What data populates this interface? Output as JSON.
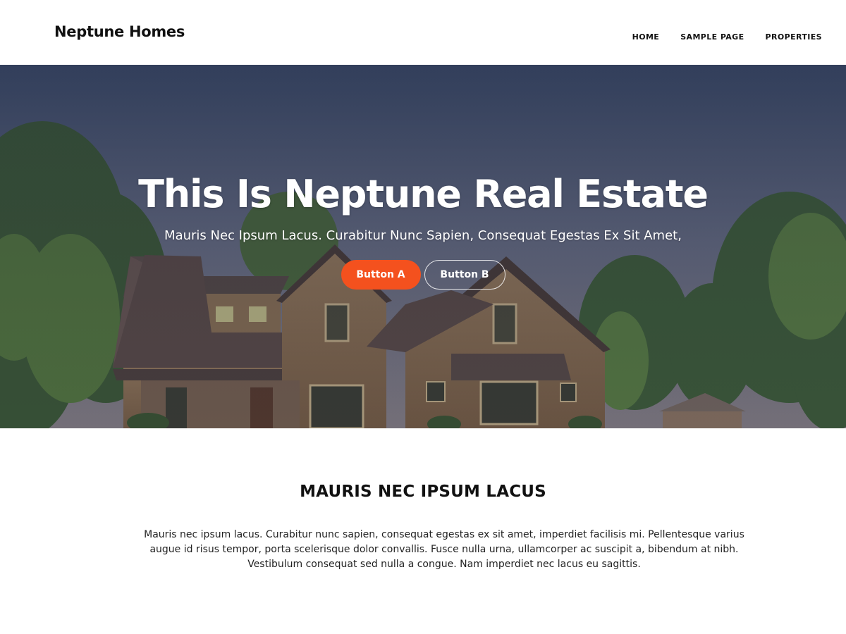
{
  "header": {
    "site_title": "Neptune Homes",
    "nav": [
      {
        "label": "HOME"
      },
      {
        "label": "SAMPLE PAGE"
      },
      {
        "label": "PROPERTIES"
      }
    ]
  },
  "hero": {
    "title": "This Is Neptune Real Estate",
    "subtitle": "Mauris Nec Ipsum Lacus. Curabitur Nunc Sapien, Consequat Egestas Ex Sit Amet,",
    "button_a": "Button A",
    "button_b": "Button B"
  },
  "section": {
    "heading": "MAURIS NEC IPSUM LACUS",
    "body": "Mauris nec ipsum lacus. Curabitur nunc sapien, consequat egestas ex sit amet, imperdiet facilisis mi. Pellentesque varius augue id risus tempor, porta scelerisque dolor convallis. Fusce nulla urna, ullamcorper ac suscipit a, bibendum at nibh. Vestibulum consequat sed nulla a congue. Nam imperdiet nec lacus eu sagittis."
  },
  "colors": {
    "accent": "#f4511e",
    "header_bg": "#ffffff",
    "text": "#111111"
  },
  "icons": {
    "hero_image": "house-photo"
  }
}
